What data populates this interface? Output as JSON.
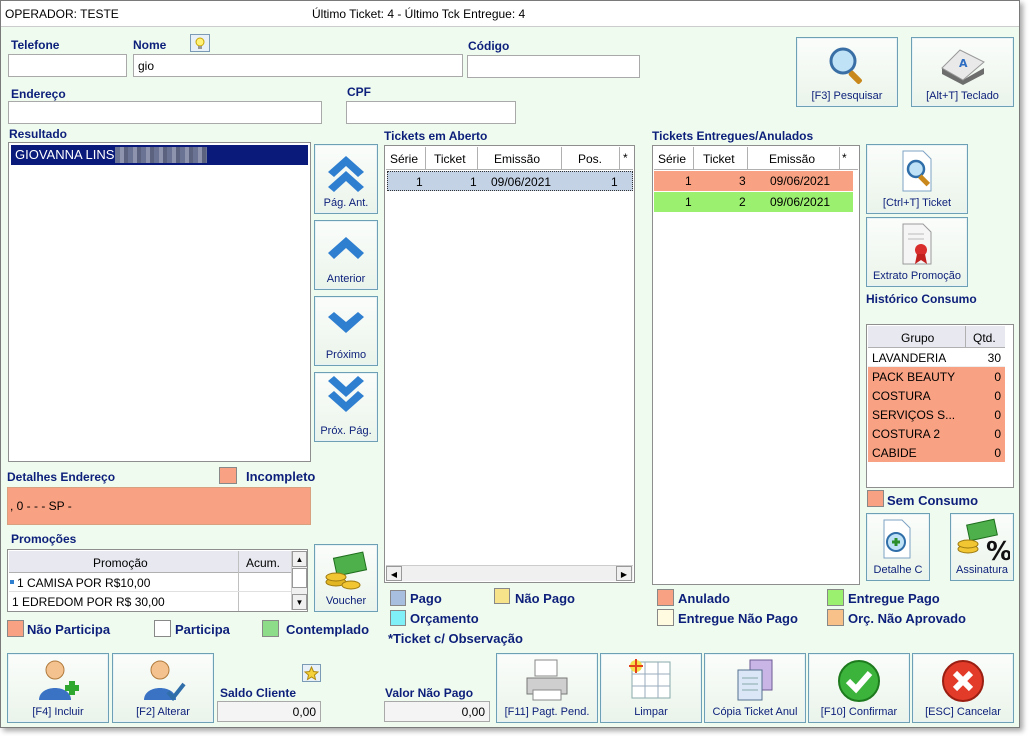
{
  "titlebar": {
    "operator": "OPERADOR: TESTE",
    "ticket_info": "Último Ticket: 4  - Último Tck Entregue: 4"
  },
  "form": {
    "telefone_label": "Telefone",
    "telefone_value": "",
    "nome_label": "Nome",
    "nome_value": "gio",
    "codigo_label": "Código",
    "codigo_value": "",
    "endereco_label": "Endereço",
    "endereco_value": "",
    "cpf_label": "CPF",
    "cpf_value": ""
  },
  "buttons": {
    "pesquisar": "[F3] Pesquisar",
    "teclado": "[Alt+T] Teclado",
    "pag_ant": "Pág. Ant.",
    "anterior": "Anterior",
    "proximo": "Próximo",
    "prox_pag": "Próx. Pág.",
    "ctrl_ticket": "[Ctrl+T] Ticket",
    "extrato": "Extrato Promoção",
    "voucher": "Voucher",
    "detalhe": "Detalhe C",
    "assinatura": "Assinatura",
    "incluir": "[F4] Incluir",
    "alterar": "[F2] Alterar",
    "pagt_pend": "[F11] Pagt. Pend.",
    "limpar": "Limpar",
    "copia": "Cópia Ticket Anul",
    "confirmar": "[F10] Confirmar",
    "cancelar": "[ESC] Cancelar"
  },
  "resultado": {
    "label": "Resultado",
    "items": [
      "GIOVANNA LINS"
    ]
  },
  "detalhes": {
    "label": "Detalhes Endereço",
    "incompleto": "Incompleto",
    "text": ", 0  -  -   - SP -"
  },
  "promocoes": {
    "label": "Promoções",
    "headers": [
      "Promoção",
      "Acum."
    ],
    "rows": [
      {
        "promo": "1 CAMISA POR R$10,00",
        "acum": ""
      },
      {
        "promo": "1 EDREDOM POR R$ 30,00",
        "acum": ""
      }
    ]
  },
  "promo_legend": {
    "nao_participa": "Não Participa",
    "participa": "Participa",
    "contemplado": "Contemplado"
  },
  "tickets_aberto": {
    "label": "Tickets em Aberto",
    "headers": [
      "Série",
      "Ticket",
      "Emissão",
      "Pos.",
      "*"
    ],
    "rows": [
      {
        "serie": "1",
        "ticket": "1",
        "emissao": "09/06/2021",
        "pos": "1"
      }
    ]
  },
  "aberto_legend": {
    "pago": "Pago",
    "nao_pago": "Não Pago",
    "orcamento": "Orçamento",
    "obs": "*Ticket c/ Observação"
  },
  "tickets_entregues": {
    "label": "Tickets Entregues/Anulados",
    "headers": [
      "Série",
      "Ticket",
      "Emissão",
      "*"
    ],
    "rows": [
      {
        "serie": "1",
        "ticket": "3",
        "emissao": "09/06/2021"
      },
      {
        "serie": "1",
        "ticket": "2",
        "emissao": "09/06/2021"
      }
    ]
  },
  "entregues_legend": {
    "anulado": "Anulado",
    "entregue_pago": "Entregue Pago",
    "entregue_nao_pago": "Entregue Não Pago",
    "orc_nao_aprovado": "Orç. Não Aprovado"
  },
  "historico": {
    "label": "Histórico Consumo",
    "headers": [
      "Grupo",
      "Qtd."
    ],
    "rows": [
      {
        "grupo": "LAVANDERIA",
        "qtd": "30"
      },
      {
        "grupo": "PACK BEAUTY",
        "qtd": "0"
      },
      {
        "grupo": "COSTURA",
        "qtd": "0"
      },
      {
        "grupo": "SERVIÇOS  S...",
        "qtd": "0"
      },
      {
        "grupo": "COSTURA 2",
        "qtd": "0"
      },
      {
        "grupo": "CABIDE",
        "qtd": "0"
      }
    ],
    "sem_consumo": "Sem Consumo"
  },
  "footer": {
    "saldo_label": "Saldo Cliente",
    "saldo_value": "0,00",
    "valor_label": "Valor Não Pago",
    "valor_value": "0,00"
  },
  "colors": {
    "accent": "#0c1f7a",
    "anulado": "#f9a283",
    "entregue_pago": "#9bf06f",
    "nao_pago": "#f7e48a",
    "orcamento": "#7ff0f7",
    "pago": "#a8bfe0",
    "selected": "#0a1a7a"
  }
}
